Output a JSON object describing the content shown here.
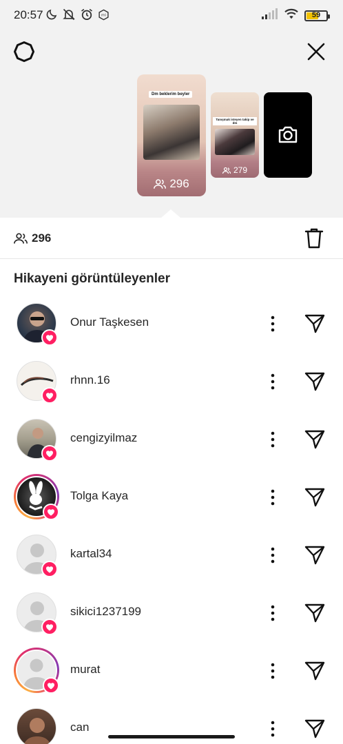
{
  "status_bar": {
    "time": "20:57",
    "battery": "59",
    "battery_level": 0.59,
    "icons_left": [
      "moon-icon",
      "notifications-off-icon",
      "alarm-icon",
      "mi-icon"
    ],
    "icons_right": [
      "signal-icon",
      "wifi-icon",
      "battery-icon"
    ]
  },
  "header": {
    "settings_icon": "gear-icon",
    "close_icon": "close-icon"
  },
  "stories": [
    {
      "caption": "Dm beklerim beyler",
      "count": "296",
      "selected": true
    },
    {
      "caption": "Tanışmak isteyen takip ve dm",
      "count": "279",
      "selected": false
    }
  ],
  "add_story_icon": "camera-icon",
  "summary": {
    "viewer_count": "296",
    "delete_icon": "trash-icon"
  },
  "section_title": "Hikayeni görüntüleyenler",
  "viewers": [
    {
      "username": "Onur Taşkesen",
      "avatar": "photo",
      "ring": false,
      "liked": true
    },
    {
      "username": "rhnn.16",
      "avatar": "photo",
      "ring": false,
      "liked": true
    },
    {
      "username": "cengizyilmaz",
      "avatar": "photo",
      "ring": false,
      "liked": true
    },
    {
      "username": "Tolga Kaya",
      "avatar": "photo",
      "ring": true,
      "liked": true
    },
    {
      "username": "kartal34",
      "avatar": "default",
      "ring": false,
      "liked": true
    },
    {
      "username": "sikici1237199",
      "avatar": "default",
      "ring": false,
      "liked": true
    },
    {
      "username": "murat",
      "avatar": "default",
      "ring": true,
      "liked": true
    },
    {
      "username": "can",
      "avatar": "photo",
      "ring": false,
      "liked": false
    }
  ],
  "colors": {
    "like_badge": "#ff1f62",
    "text": "#262626",
    "top_background": "#f2f2f2"
  }
}
